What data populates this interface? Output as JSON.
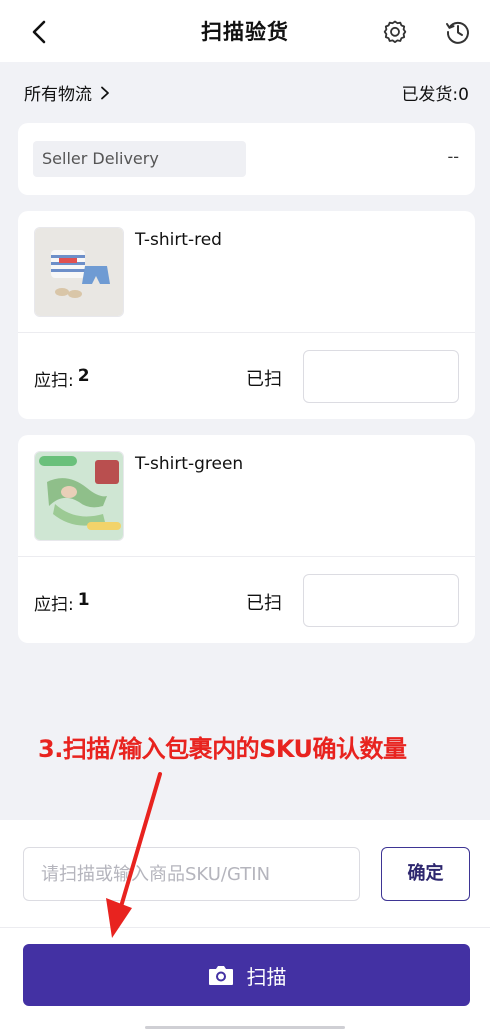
{
  "header": {
    "title": "扫描验货",
    "back_icon": "chevron-left-icon",
    "settings_icon": "gear-icon",
    "history_icon": "history-icon"
  },
  "filter": {
    "carrier_label": "所有物流",
    "shipped_label": "已发货:",
    "shipped_count": "0"
  },
  "seller": {
    "name": "Seller Delivery",
    "value": "--"
  },
  "items": [
    {
      "name": "T-shirt-red",
      "expected_label": "应扫:",
      "expected_qty": "2",
      "scanned_label": "已扫",
      "scanned_value": ""
    },
    {
      "name": "T-shirt-green",
      "expected_label": "应扫:",
      "expected_qty": "1",
      "scanned_label": "已扫",
      "scanned_value": ""
    }
  ],
  "annotation": {
    "text": "3.扫描/输入包裹内的SKU确认数量",
    "color": "#e8231f"
  },
  "sku_input": {
    "placeholder": "请扫描或输入商品SKU/GTIN",
    "value": ""
  },
  "confirm_button": {
    "label": "确定"
  },
  "scan_button": {
    "label": "扫描",
    "icon": "camera-icon"
  },
  "colors": {
    "primary": "#4331a3",
    "background": "#f1f2f6"
  }
}
